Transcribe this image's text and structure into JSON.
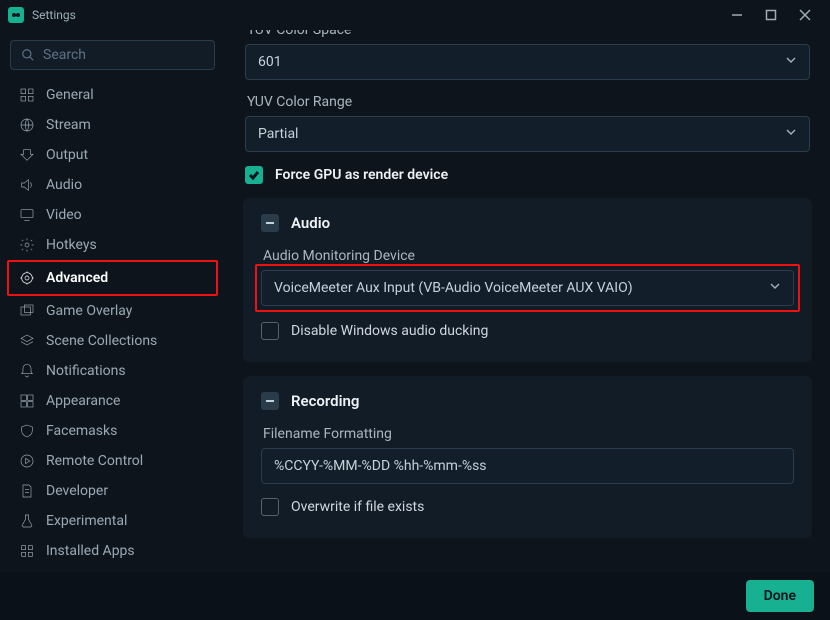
{
  "window": {
    "title": "Settings"
  },
  "search": {
    "placeholder": "Search"
  },
  "sidebar": {
    "items": [
      {
        "label": "General",
        "icon": "grid-icon"
      },
      {
        "label": "Stream",
        "icon": "globe-icon"
      },
      {
        "label": "Output",
        "icon": "export-icon"
      },
      {
        "label": "Audio",
        "icon": "volume-icon"
      },
      {
        "label": "Video",
        "icon": "monitor-icon"
      },
      {
        "label": "Hotkeys",
        "icon": "gear-icon"
      },
      {
        "label": "Advanced",
        "icon": "sliders-icon",
        "active": true
      },
      {
        "label": "Game Overlay",
        "icon": "overlay-icon"
      },
      {
        "label": "Scene Collections",
        "icon": "layers-icon"
      },
      {
        "label": "Notifications",
        "icon": "bell-icon"
      },
      {
        "label": "Appearance",
        "icon": "appearance-icon"
      },
      {
        "label": "Facemasks",
        "icon": "shield-icon"
      },
      {
        "label": "Remote Control",
        "icon": "play-circle-icon"
      },
      {
        "label": "Developer",
        "icon": "doc-icon"
      },
      {
        "label": "Experimental",
        "icon": "flask-icon"
      },
      {
        "label": "Installed Apps",
        "icon": "apps-icon"
      }
    ]
  },
  "video": {
    "yuv_space_label": "YUV Color Space",
    "yuv_space_value": "601",
    "yuv_range_label": "YUV Color Range",
    "yuv_range_value": "Partial",
    "force_gpu_label": "Force GPU as render device",
    "force_gpu_checked": true
  },
  "audio": {
    "section_title": "Audio",
    "monitoring_label": "Audio Monitoring Device",
    "monitoring_value": "VoiceMeeter Aux Input (VB-Audio VoiceMeeter AUX VAIO)",
    "ducking_label": "Disable Windows audio ducking",
    "ducking_checked": false
  },
  "recording": {
    "section_title": "Recording",
    "filename_label": "Filename Formatting",
    "filename_value": "%CCYY-%MM-%DD %hh-%mm-%ss",
    "overwrite_label": "Overwrite if file exists",
    "overwrite_checked": false
  },
  "footer": {
    "done_label": "Done"
  }
}
